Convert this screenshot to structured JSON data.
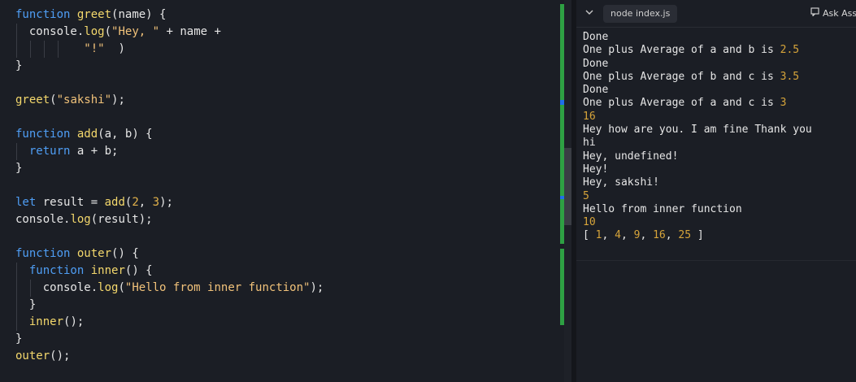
{
  "editor": {
    "lines": [
      [
        {
          "t": "function",
          "c": "k"
        },
        {
          "t": " ",
          "c": "p"
        },
        {
          "t": "greet",
          "c": "f"
        },
        {
          "t": "(name) {",
          "c": "p"
        }
      ],
      [
        {
          "t": "  console.",
          "c": "p"
        },
        {
          "t": "log",
          "c": "f"
        },
        {
          "t": "(",
          "c": "p"
        },
        {
          "t": "\"Hey, \"",
          "c": "s"
        },
        {
          "t": " + name +",
          "c": "p"
        }
      ],
      [
        {
          "t": "          ",
          "c": "p"
        },
        {
          "t": "\"!\"",
          "c": "s"
        },
        {
          "t": "  )",
          "c": "p"
        }
      ],
      [
        {
          "t": "}",
          "c": "p"
        }
      ],
      [],
      [
        {
          "t": "greet",
          "c": "f"
        },
        {
          "t": "(",
          "c": "p"
        },
        {
          "t": "\"sakshi\"",
          "c": "s"
        },
        {
          "t": ");",
          "c": "p"
        }
      ],
      [],
      [
        {
          "t": "function",
          "c": "k"
        },
        {
          "t": " ",
          "c": "p"
        },
        {
          "t": "add",
          "c": "f"
        },
        {
          "t": "(a, b) {",
          "c": "p"
        }
      ],
      [
        {
          "t": "  ",
          "c": "p"
        },
        {
          "t": "return",
          "c": "k"
        },
        {
          "t": " a + b;",
          "c": "p"
        }
      ],
      [
        {
          "t": "}",
          "c": "p"
        }
      ],
      [],
      [
        {
          "t": "let",
          "c": "k"
        },
        {
          "t": " result = ",
          "c": "p"
        },
        {
          "t": "add",
          "c": "f"
        },
        {
          "t": "(",
          "c": "p"
        },
        {
          "t": "2",
          "c": "n"
        },
        {
          "t": ", ",
          "c": "p"
        },
        {
          "t": "3",
          "c": "n"
        },
        {
          "t": ");",
          "c": "p"
        }
      ],
      [
        {
          "t": "console.",
          "c": "p"
        },
        {
          "t": "log",
          "c": "f"
        },
        {
          "t": "(result);",
          "c": "p"
        }
      ],
      [],
      [
        {
          "t": "function",
          "c": "k"
        },
        {
          "t": " ",
          "c": "p"
        },
        {
          "t": "outer",
          "c": "f"
        },
        {
          "t": "() {",
          "c": "p"
        }
      ],
      [
        {
          "t": "  ",
          "c": "p"
        },
        {
          "t": "function",
          "c": "k"
        },
        {
          "t": " ",
          "c": "p"
        },
        {
          "t": "inner",
          "c": "f"
        },
        {
          "t": "() {",
          "c": "p"
        }
      ],
      [
        {
          "t": "    console.",
          "c": "p"
        },
        {
          "t": "log",
          "c": "f"
        },
        {
          "t": "(",
          "c": "p"
        },
        {
          "t": "\"Hello from inner function\"",
          "c": "s"
        },
        {
          "t": ");",
          "c": "p"
        }
      ],
      [
        {
          "t": "  }",
          "c": "p"
        }
      ],
      [
        {
          "t": "  ",
          "c": "p"
        },
        {
          "t": "inner",
          "c": "f"
        },
        {
          "t": "();",
          "c": "p"
        }
      ],
      [
        {
          "t": "}",
          "c": "p"
        }
      ],
      [
        {
          "t": "outer",
          "c": "f"
        },
        {
          "t": "();",
          "c": "p"
        }
      ]
    ]
  },
  "terminal": {
    "tab_label": "node index.js",
    "ask_label": "Ask Ass",
    "output": [
      [
        {
          "t": "Done"
        }
      ],
      [
        {
          "t": "One plus Average of a and b is "
        },
        {
          "t": "2.5",
          "c": "num"
        }
      ],
      [
        {
          "t": "Done"
        }
      ],
      [
        {
          "t": "One plus Average of b and c is "
        },
        {
          "t": "3.5",
          "c": "num"
        }
      ],
      [
        {
          "t": "Done"
        }
      ],
      [
        {
          "t": "One plus Average of a and c is "
        },
        {
          "t": "3",
          "c": "num"
        }
      ],
      [
        {
          "t": "16",
          "c": "num"
        }
      ],
      [
        {
          "t": "Hey how are you. I am fine Thank you"
        }
      ],
      [
        {
          "t": "hi"
        }
      ],
      [
        {
          "t": "Hey, undefined!"
        }
      ],
      [
        {
          "t": "Hey!"
        }
      ],
      [
        {
          "t": "Hey, sakshi!"
        }
      ],
      [
        {
          "t": "5",
          "c": "num"
        }
      ],
      [
        {
          "t": "Hello from inner function"
        }
      ],
      [
        {
          "t": "10",
          "c": "num"
        }
      ],
      [
        {
          "t": "[ "
        },
        {
          "t": "1",
          "c": "num"
        },
        {
          "t": ", "
        },
        {
          "t": "4",
          "c": "num"
        },
        {
          "t": ", "
        },
        {
          "t": "9",
          "c": "num"
        },
        {
          "t": ", "
        },
        {
          "t": "16",
          "c": "num"
        },
        {
          "t": ", "
        },
        {
          "t": "25",
          "c": "num"
        },
        {
          "t": " ]"
        }
      ]
    ]
  },
  "colors": {
    "keyword": "#4f9ef5",
    "function_name": "#f4d86c",
    "string": "#f1c27a",
    "number": "#e2b24b",
    "terminal_number": "#d6a43a",
    "gutter_added": "#2ea043",
    "gutter_modified": "#1f6feb"
  },
  "icons": {
    "collapse": "chevron-down-icon",
    "ask": "ask-assistant-icon"
  }
}
